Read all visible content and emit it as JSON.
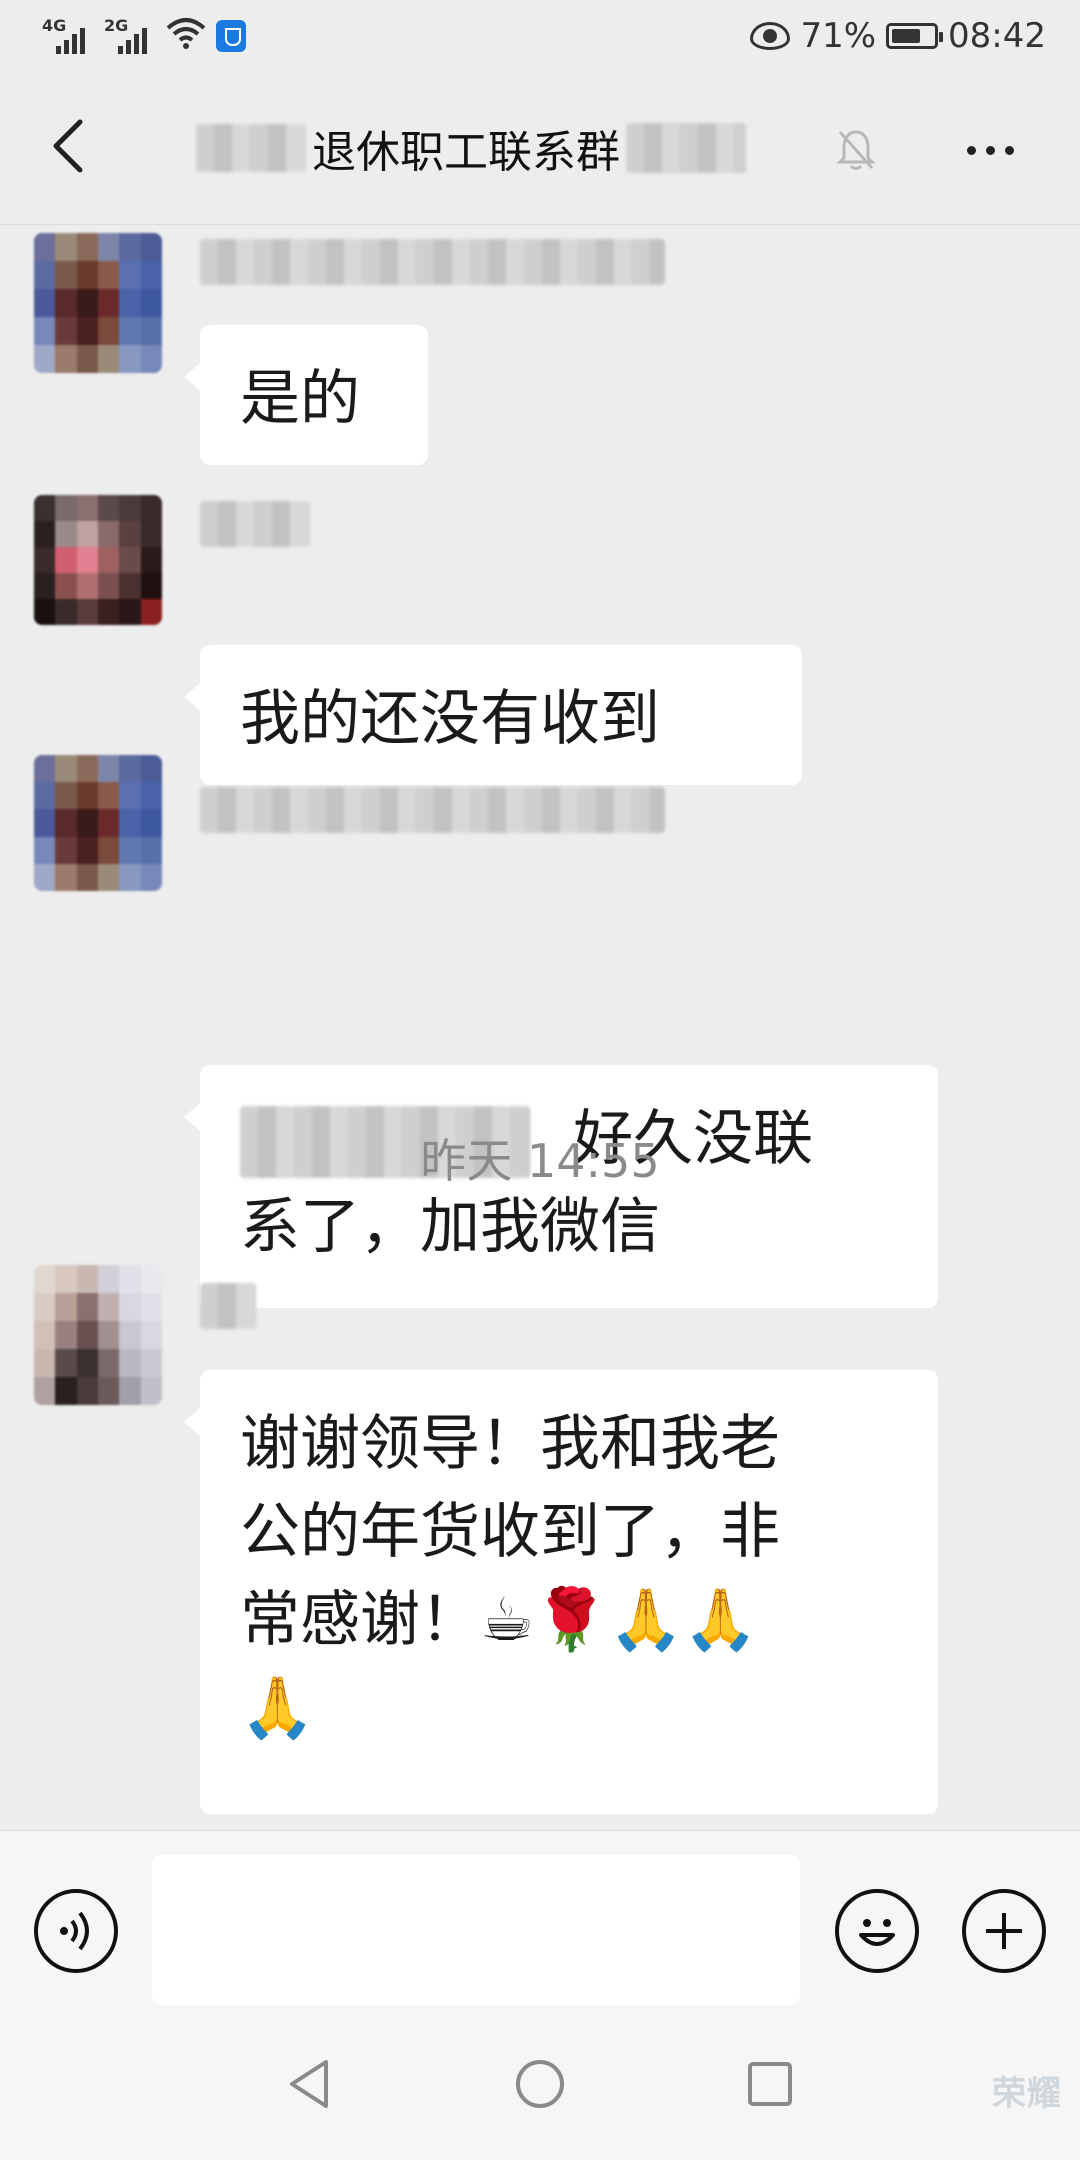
{
  "status_bar": {
    "signal_1_network": "4G",
    "signal_2_network": "2G",
    "battery_percent": "71%",
    "battery_level": 0.71,
    "time": "08:42",
    "icons": [
      "signal-icon",
      "wifi-icon",
      "security-shield-icon",
      "eye-comfort-icon",
      "battery-icon"
    ]
  },
  "header": {
    "title": "退休职工联系群",
    "icons": [
      "back-arrow-icon",
      "mute-bell-icon",
      "more-dots-icon"
    ]
  },
  "messages": [
    {
      "text": "是的"
    },
    {
      "text": "我的还没有收到"
    },
    {
      "text_lines": [
        "好久没联",
        "系了，加我微信"
      ]
    },
    {
      "time_label": "昨天 14:55"
    },
    {
      "text_lines": [
        "谢谢领导！我和我老",
        "公的年货收到了，非",
        "常感谢！☕🌹🙏🙏",
        "🙏"
      ]
    }
  ],
  "input_bar": {
    "input_value": "",
    "icons": [
      "voice-icon",
      "emoji-icon",
      "plus-icon"
    ]
  },
  "nav_bar": {
    "icons": [
      "nav-back-icon",
      "nav-home-icon",
      "nav-recent-icon"
    ],
    "watermark": "荣耀"
  },
  "colors": {
    "background": "#ededed",
    "bubble": "#ffffff",
    "time_label": "#8a8a8a",
    "shield": "#1a7ae0"
  }
}
